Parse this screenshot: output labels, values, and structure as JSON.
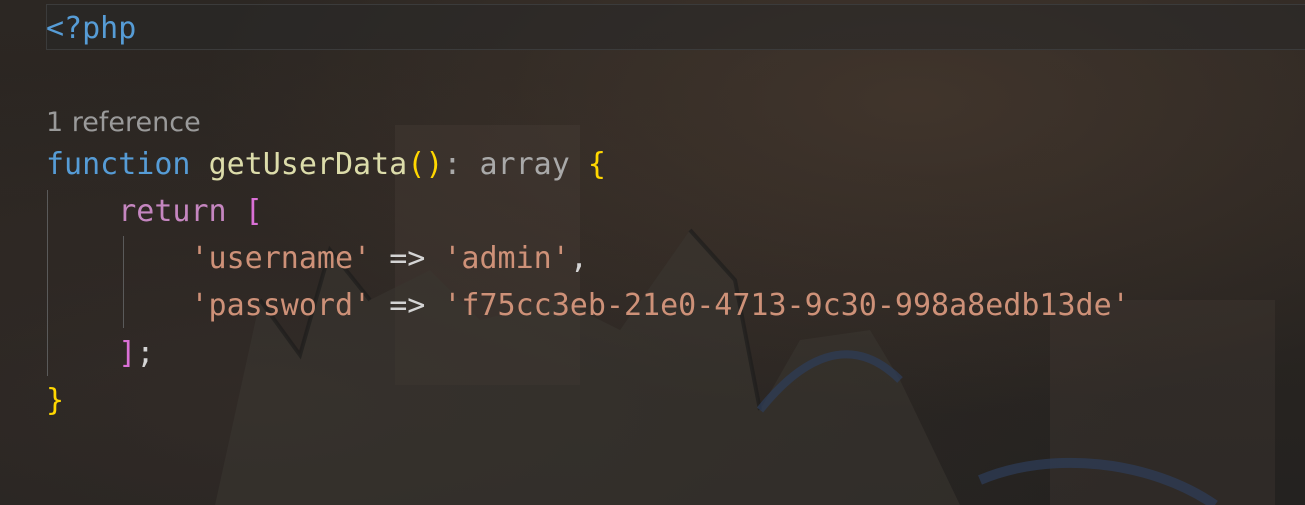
{
  "colors": {
    "keyword": "#569cd6",
    "control": "#c586c0",
    "function": "#dcdcaa",
    "bracket_gold": "#ffd700",
    "bracket_violet": "#da70d6",
    "type": "#a9a9a9",
    "string": "#ce9178",
    "codelens": "#9a9a9a"
  },
  "code": {
    "line1": {
      "open_tag": "<?php"
    },
    "codelens": "1 reference",
    "line2": {
      "keyword": "function",
      "name": "getUserData",
      "open_paren": "(",
      "close_paren": ")",
      "colon": ":",
      "return_type": "array",
      "open_brace": "{"
    },
    "line3": {
      "keyword": "return",
      "open_bracket": "["
    },
    "line4": {
      "key": "'username'",
      "arrow": "=>",
      "value": "'admin'",
      "comma": ","
    },
    "line5": {
      "key": "'password'",
      "arrow": "=>",
      "value": "'f75cc3eb-21e0-4713-9c30-998a8edb13de'"
    },
    "line6": {
      "close_bracket": "]",
      "semicolon": ";"
    },
    "line7": {
      "close_brace": "}"
    }
  },
  "background": {
    "icon": "fox-character-wallpaper"
  }
}
